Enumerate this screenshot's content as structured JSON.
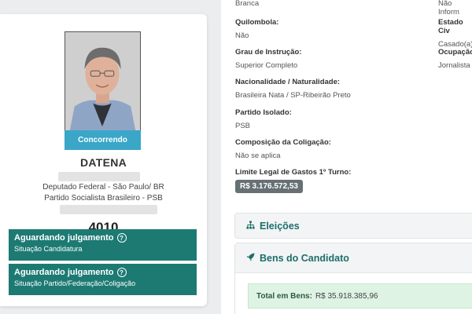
{
  "candidate": {
    "status_tag": "Concorrendo",
    "name": "DATENA",
    "office_line": "Deputado Federal - São Paulo/ BR",
    "party_line": "Partido Socialista Brasileiro - PSB",
    "number": "4010",
    "status_boxes": [
      {
        "title": "Aguardando julgamento",
        "subtitle": "Situação Candidatura"
      },
      {
        "title": "Aguardando julgamento",
        "subtitle": "Situação Partido/Federação/Coligação"
      }
    ]
  },
  "details": {
    "cor_raca_value": "Branca",
    "right_top_value": "Não Inform",
    "quilombola": {
      "label": "Quilombola:",
      "value": "Não"
    },
    "estado_civil": {
      "label": "Estado Civ",
      "value": "Casado(a)"
    },
    "grau_instrucao": {
      "label": "Grau de Instrução:",
      "value": "Superior Completo"
    },
    "ocupacao": {
      "label": "Ocupação:",
      "value": "Jornalista"
    },
    "nacionalidade": {
      "label": "Nacionalidade / Naturalidade:",
      "value": "Brasileira Nata / SP-Ribeirão Preto"
    },
    "partido_isolado": {
      "label": "Partido Isolado:",
      "value": "PSB"
    },
    "coligacao": {
      "label": "Composição da Coligação:",
      "value": "Não se aplica"
    },
    "limite": {
      "label": "Limite Legal de Gastos 1º Turno:",
      "value": "R$ 3.176.572,53"
    }
  },
  "sections": {
    "eleicoes": "Eleições",
    "bens": "Bens do Candidato",
    "total_label": "Total em Bens:",
    "total_value": "R$ 35.918.385,96"
  },
  "icons": {
    "eleicoes": "sitemap-icon",
    "bens": "rocket-icon",
    "help": "question-circle-icon"
  },
  "colors": {
    "accent_teal": "#1d7a73",
    "status_blue": "#3aa6c8",
    "badge_gray": "#667075",
    "total_green_bg": "#dff3e5"
  }
}
